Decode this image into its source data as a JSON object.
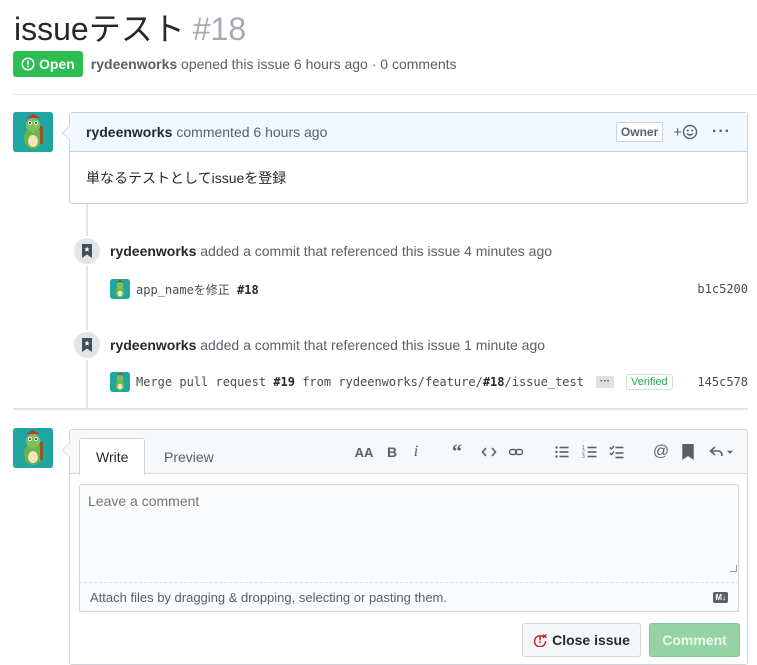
{
  "issue": {
    "title": "issueテスト",
    "number": "#18",
    "state": "Open",
    "author": "rydeenworks",
    "meta_suffix": "opened this issue 6 hours ago · 0 comments"
  },
  "comment": {
    "author": "rydeenworks",
    "when": "commented 6 hours ago",
    "role": "Owner",
    "body": "単なるテストとしてissueを登録"
  },
  "timeline": [
    {
      "actor": "rydeenworks",
      "action": "added a commit that referenced this issue 4 minutes ago",
      "commit_msg": "app_nameを修正 ",
      "commit_ref": "#18",
      "sha": "b1c5200"
    },
    {
      "actor": "rydeenworks",
      "action": "added a commit that referenced this issue 1 minute ago",
      "commit_msg_prefix": "Merge pull request ",
      "commit_pr": "#19",
      "commit_msg_mid": " from rydeenworks/feature/",
      "commit_ref": "#18",
      "commit_msg_suffix": "/issue_test",
      "ellipsis": "···",
      "verified": "Verified",
      "sha": "145c578"
    }
  ],
  "form": {
    "tab_write": "Write",
    "tab_preview": "Preview",
    "placeholder": "Leave a comment",
    "attach_hint": "Attach files by dragging & dropping, selecting or pasting them.",
    "md_badge": "M↓",
    "close_label": "Close issue",
    "comment_label": "Comment"
  },
  "toolbar_icons": [
    "text-size-icon",
    "bold-icon",
    "italic-icon",
    "quote-icon",
    "code-icon",
    "link-icon",
    "unordered-list-icon",
    "ordered-list-icon",
    "task-list-icon",
    "mention-icon",
    "saved-reply-icon",
    "reply-icon"
  ],
  "colors": {
    "open_green": "#2cbe4e",
    "comment_header_bg": "#f1f8ff",
    "comment_border": "#c0d3eb",
    "avatar_teal": "#1fa6a0",
    "comment_button_disabled": "#94d3a2",
    "close_icon_red": "#cb2431"
  }
}
